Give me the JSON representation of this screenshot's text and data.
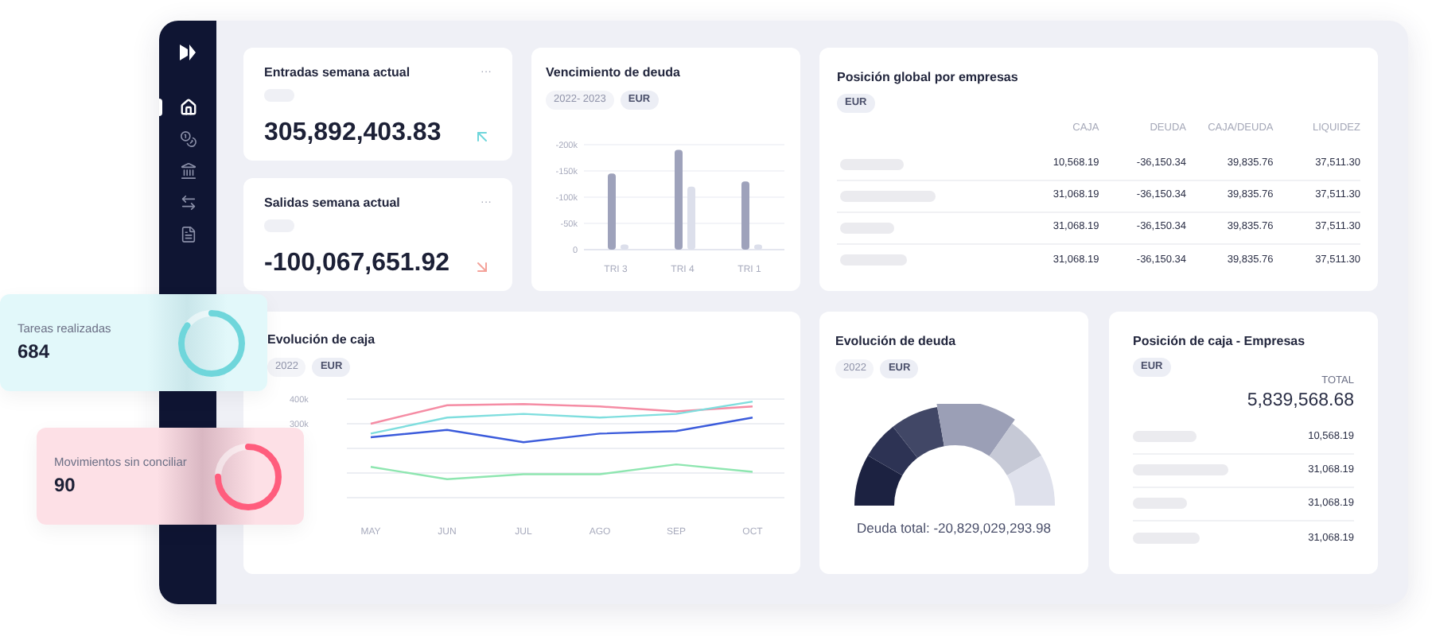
{
  "sidebar": {
    "items": [
      {
        "selected": true
      },
      {
        "selected": false
      },
      {
        "selected": false
      },
      {
        "selected": false
      },
      {
        "selected": false
      }
    ]
  },
  "kpis": [
    {
      "title": "Entradas semana actual",
      "menu": "···",
      "value": "305,892,403.83",
      "kind": "up"
    },
    {
      "title": "Salidas semana actual",
      "menu": "···",
      "value": "-100,067,651.92",
      "kind": "down"
    }
  ],
  "vencimiento": {
    "title": "Vencimiento de deuda",
    "chips": [
      {
        "label": "2022- 2023",
        "disabled": true
      },
      {
        "label": "EUR",
        "disabled": false
      }
    ],
    "chart_data": {
      "type": "bar",
      "categories": [
        "TRI 3",
        "TRI 4",
        "TRI 1"
      ],
      "series": [
        {
          "color": "#9ea2bb",
          "values": [
            -145000,
            -190000,
            -130000
          ]
        },
        {
          "color": "#dcdfeb",
          "values": [
            -10000,
            -120000,
            -10000
          ]
        }
      ],
      "grid": true,
      "ylim": [
        0,
        -200000
      ],
      "yticks": [
        {
          "value": -200000,
          "label": "-200k"
        },
        {
          "value": -150000,
          "label": "-150k"
        },
        {
          "value": -100000,
          "label": "-100k"
        },
        {
          "value": -50000,
          "label": "-50k"
        },
        {
          "value": 0,
          "label": "0"
        }
      ]
    }
  },
  "posicion_global": {
    "title": "Posición global por empresas",
    "chip": "EUR",
    "columns": [
      "CAJA",
      "DEUDA",
      "CAJA/DEUDA",
      "LIQUIDEZ"
    ],
    "rows": [
      [
        "10,568.19",
        "-36,150.34",
        "39,835.76",
        "37,511.30"
      ],
      [
        "31,068.19",
        "-36,150.34",
        "39,835.76",
        "37,511.30"
      ],
      [
        "31,068.19",
        "-36,150.34",
        "39,835.76",
        "37,511.30"
      ],
      [
        "31,068.19",
        "-36,150.34",
        "39,835.76",
        "37,511.30"
      ]
    ]
  },
  "evolucion_caja": {
    "title": "Evolución de caja",
    "chips": [
      {
        "label": "2022",
        "disabled": true
      },
      {
        "label": "EUR",
        "disabled": false
      }
    ],
    "chart_data": {
      "type": "line",
      "categories": [
        "MAY",
        "JUN",
        "JUL",
        "AGO",
        "SEP",
        "OCT"
      ],
      "series": [
        {
          "color": "#f58ca4",
          "values": [
            300000,
            375000,
            380000,
            370000,
            350000,
            370000
          ]
        },
        {
          "color": "#7fdede",
          "values": [
            260000,
            325000,
            340000,
            325000,
            340000,
            390000
          ]
        },
        {
          "color": "#3b5bdb",
          "values": [
            245000,
            275000,
            225000,
            260000,
            270000,
            325000
          ]
        },
        {
          "color": "#8ee6b0",
          "values": [
            125000,
            75000,
            95000,
            95000,
            135000,
            105000
          ]
        }
      ],
      "grid": true,
      "ylim": [
        0,
        400000
      ],
      "yticks": [
        {
          "value": 400000,
          "label": "400k"
        },
        {
          "value": 300000,
          "label": "300k"
        }
      ]
    }
  },
  "evolucion_deuda": {
    "title": "Evolución de deuda",
    "chips": [
      {
        "label": "2022",
        "disabled": true
      },
      {
        "label": "EUR",
        "disabled": false
      }
    ],
    "total": "Deuda total: -20,829,029,293.98"
  },
  "posicion_caja": {
    "title": "Posición de caja - Empresas",
    "chip": "EUR",
    "total_label": "TOTAL",
    "total": "5,839,568.68",
    "rows": [
      "10,568.19",
      "31,068.19",
      "31,068.19",
      "31,068.19"
    ]
  },
  "floating": [
    {
      "title": "Tareas realizadas",
      "value": "684",
      "level": 0.85,
      "kind": "done"
    },
    {
      "title": "Movimientos sin conciliar",
      "value": "90",
      "level": 0.75,
      "kind": "pending"
    }
  ]
}
